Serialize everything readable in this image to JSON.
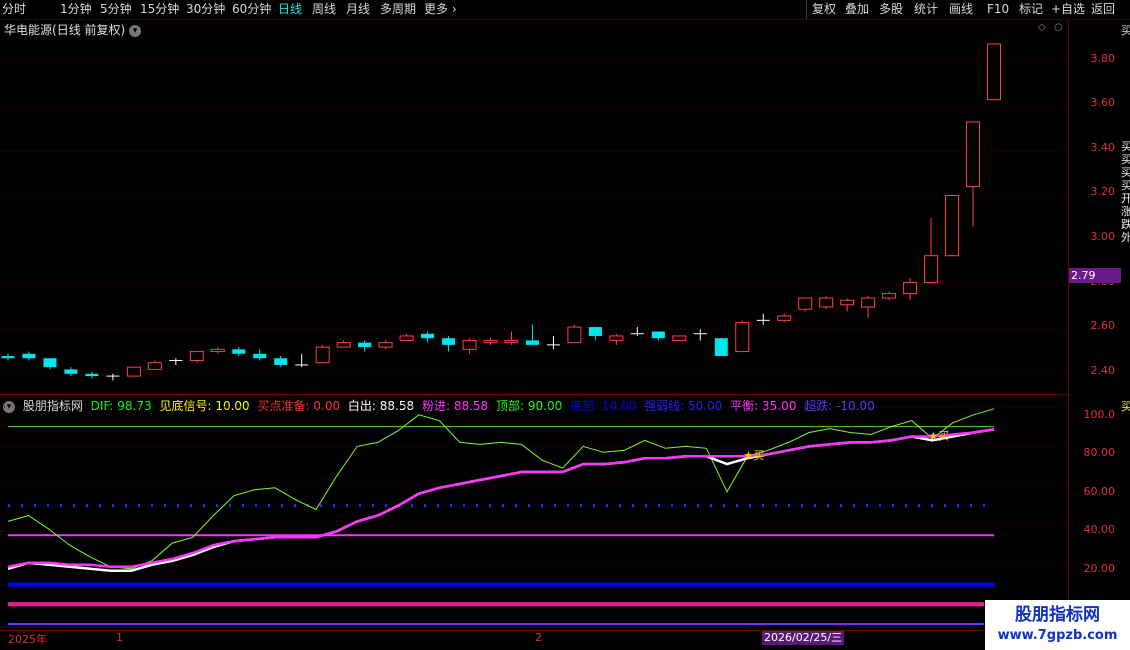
{
  "toolbar": {
    "periods": [
      "分时",
      "1分钟",
      "5分钟",
      "15分钟",
      "30分钟",
      "60分钟",
      "日线",
      "周线",
      "月线",
      "多周期",
      "更多"
    ],
    "active_period": "日线",
    "tools": [
      "复权",
      "叠加",
      "多股",
      "统计",
      "画线",
      "F10",
      "标记",
      "+自选",
      "返回"
    ]
  },
  "stock": {
    "name": "华电能源",
    "mode": "(日线 前复权)"
  },
  "price_axis": {
    "ticks": [
      "3.80",
      "3.60",
      "3.40",
      "3.20",
      "3.00",
      "2.80",
      "2.60",
      "2.40"
    ],
    "current_price": "2.79"
  },
  "indicator": {
    "name": "股朋指标网",
    "legend": [
      {
        "label": "DIF: 98.73",
        "color": "#00ff00"
      },
      {
        "label": "见底信号: 10.00",
        "color": "#ffff00"
      },
      {
        "label": "买点准备: 0.00",
        "color": "#ff3030"
      },
      {
        "label": "白出: 88.58",
        "color": "#ffffff"
      },
      {
        "label": "粉进: 88.58",
        "color": "#ff33ff"
      },
      {
        "label": "顶部: 90.00",
        "color": "#22ff22"
      },
      {
        "label": "底部: 10.00",
        "color": "#0000ff"
      },
      {
        "label": "强弱线: 50.00",
        "color": "#2222ff"
      },
      {
        "label": "平衡: 35.00",
        "color": "#ff33ff"
      },
      {
        "label": "超跌: -10.00",
        "color": "#6633ff"
      }
    ],
    "axis_ticks": [
      "100.0",
      "80.00",
      "60.00",
      "40.00",
      "20.00"
    ],
    "buy_label": "★买"
  },
  "timeline": {
    "labels": [
      "2025年",
      "1",
      "2"
    ],
    "cursor_date": "2026/02/25/三"
  },
  "right_strip": {
    "top": "买",
    "middle": "买买买买开涨跌外",
    "bottom": "买"
  },
  "watermark": {
    "site_name": "股朋指标网",
    "url": "www.7gpzb.com"
  },
  "colors": {
    "up": "#ff4040",
    "down": "#00e5ee",
    "dif": "#7cff2a",
    "pink": "#ff33ff",
    "blue": "#0000ff"
  },
  "chart_data": [
    {
      "type": "candlestick",
      "title": "华电能源 (日线 前复权)",
      "ylim": [
        2.35,
        3.92
      ],
      "ohlc": [
        [
          2.48,
          2.49,
          2.46,
          2.47
        ],
        [
          2.49,
          2.5,
          2.46,
          2.47
        ],
        [
          2.47,
          2.47,
          2.42,
          2.43
        ],
        [
          2.42,
          2.43,
          2.39,
          2.4
        ],
        [
          2.4,
          2.41,
          2.38,
          2.39
        ],
        [
          2.39,
          2.4,
          2.37,
          2.39
        ],
        [
          2.39,
          2.43,
          2.39,
          2.43
        ],
        [
          2.42,
          2.46,
          2.42,
          2.45
        ],
        [
          2.46,
          2.47,
          2.44,
          2.46
        ],
        [
          2.46,
          2.5,
          2.45,
          2.5
        ],
        [
          2.5,
          2.52,
          2.49,
          2.51
        ],
        [
          2.51,
          2.52,
          2.48,
          2.49
        ],
        [
          2.49,
          2.51,
          2.46,
          2.47
        ],
        [
          2.47,
          2.48,
          2.43,
          2.44
        ],
        [
          2.44,
          2.49,
          2.43,
          2.44
        ],
        [
          2.45,
          2.53,
          2.45,
          2.52
        ],
        [
          2.52,
          2.55,
          2.52,
          2.54
        ],
        [
          2.54,
          2.55,
          2.5,
          2.52
        ],
        [
          2.52,
          2.55,
          2.51,
          2.54
        ],
        [
          2.55,
          2.58,
          2.55,
          2.57
        ],
        [
          2.58,
          2.59,
          2.54,
          2.56
        ],
        [
          2.56,
          2.57,
          2.5,
          2.53
        ],
        [
          2.51,
          2.56,
          2.49,
          2.55
        ],
        [
          2.54,
          2.56,
          2.53,
          2.55
        ],
        [
          2.54,
          2.59,
          2.53,
          2.55
        ],
        [
          2.55,
          2.62,
          2.53,
          2.53
        ],
        [
          2.53,
          2.57,
          2.51,
          2.53
        ],
        [
          2.54,
          2.62,
          2.54,
          2.61
        ],
        [
          2.61,
          2.61,
          2.55,
          2.57
        ],
        [
          2.55,
          2.58,
          2.53,
          2.57
        ],
        [
          2.58,
          2.61,
          2.57,
          2.58
        ],
        [
          2.59,
          2.59,
          2.55,
          2.56
        ],
        [
          2.55,
          2.57,
          2.55,
          2.57
        ],
        [
          2.58,
          2.6,
          2.55,
          2.58
        ],
        [
          2.56,
          2.56,
          2.49,
          2.48
        ],
        [
          2.5,
          2.64,
          2.5,
          2.63
        ],
        [
          2.64,
          2.67,
          2.62,
          2.64
        ],
        [
          2.64,
          2.67,
          2.63,
          2.66
        ],
        [
          2.69,
          2.74,
          2.68,
          2.74
        ],
        [
          2.7,
          2.75,
          2.69,
          2.74
        ],
        [
          2.71,
          2.74,
          2.68,
          2.73
        ],
        [
          2.7,
          2.75,
          2.65,
          2.74
        ],
        [
          2.74,
          2.77,
          2.73,
          2.76
        ],
        [
          2.76,
          2.83,
          2.73,
          2.81
        ],
        [
          2.81,
          3.1,
          2.81,
          2.93
        ],
        [
          2.93,
          3.2,
          2.93,
          3.2
        ],
        [
          3.24,
          3.53,
          3.06,
          3.53
        ],
        [
          3.63,
          3.88,
          3.63,
          3.88
        ]
      ]
    },
    {
      "type": "line",
      "title": "股朋指标网",
      "ylim": [
        -12,
        105
      ],
      "series": [
        {
          "name": "DIF",
          "values": [
            42,
            45,
            38,
            30,
            24,
            19,
            18,
            22,
            31,
            34,
            45,
            55,
            58,
            59,
            53,
            48,
            65,
            80,
            82,
            88,
            96,
            93,
            82,
            81,
            82,
            81,
            73,
            69,
            80,
            77,
            78,
            83,
            79,
            80,
            79,
            57,
            75,
            78,
            82,
            87,
            89,
            87,
            86,
            90,
            93,
            84,
            92,
            96,
            99
          ]
        },
        {
          "name": "白出",
          "values": [
            18,
            21,
            20,
            19,
            18,
            17,
            17,
            20,
            22,
            25,
            29,
            32,
            33,
            34,
            34,
            34,
            37,
            42,
            45,
            50,
            56,
            59,
            61,
            63,
            65,
            67,
            67,
            67,
            71,
            71,
            72,
            74,
            74,
            75,
            75,
            71,
            74,
            76,
            78,
            80,
            81,
            82,
            82,
            83,
            85,
            83,
            85,
            87,
            88.58
          ]
        },
        {
          "name": "粉进",
          "values": [
            19,
            21,
            21,
            20,
            20,
            19,
            19,
            21,
            23,
            26,
            30,
            32,
            33,
            34,
            34,
            34,
            37,
            42,
            45,
            50,
            56,
            59,
            61,
            63,
            65,
            67,
            67,
            67,
            71,
            71,
            72,
            74,
            74,
            75,
            75,
            75,
            75,
            76,
            78,
            80,
            81,
            82,
            82,
            83,
            85,
            85,
            86,
            87,
            88.58
          ]
        },
        {
          "name": "顶部",
          "values": [
            90
          ]
        },
        {
          "name": "强弱线",
          "values": [
            50
          ]
        },
        {
          "name": "平衡",
          "values": [
            35
          ]
        },
        {
          "name": "底部",
          "values": [
            10
          ]
        },
        {
          "name": "超跌",
          "values": [
            -10
          ]
        }
      ]
    }
  ]
}
